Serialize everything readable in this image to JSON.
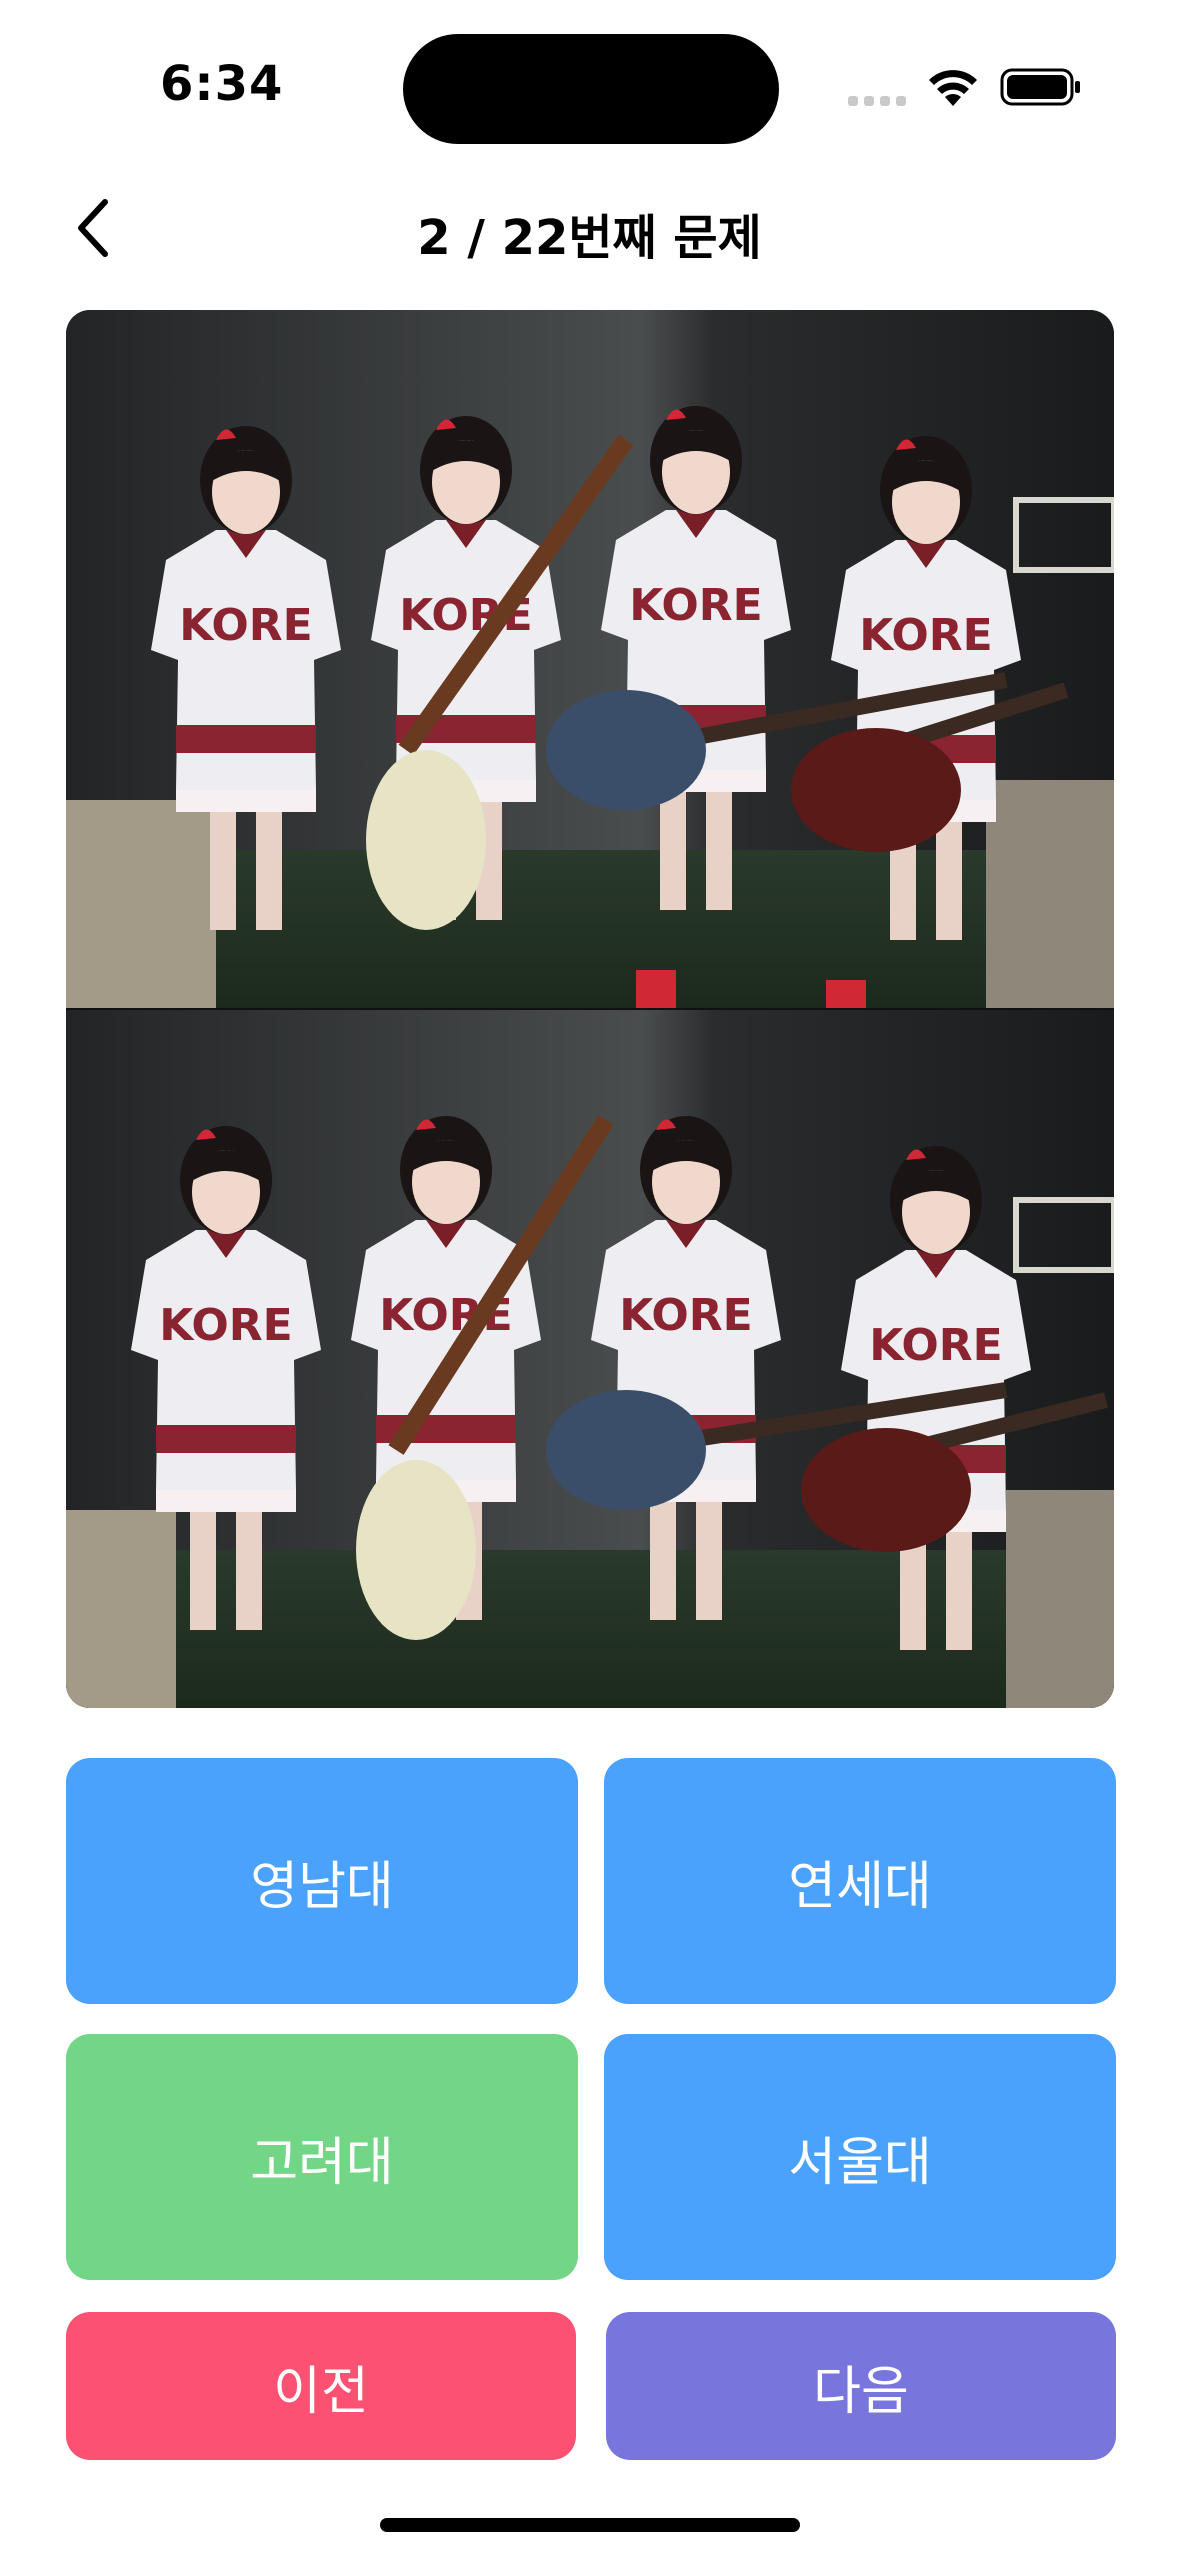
{
  "status_bar": {
    "time": "6:34",
    "icons": [
      "signal-icon",
      "wifi-icon",
      "battery-icon"
    ]
  },
  "header": {
    "title": "2 / 22번째 문제",
    "back_icon": "chevron-left-icon"
  },
  "photo": {
    "description_icon": "quiz-photo",
    "panels": 2
  },
  "answers": [
    {
      "label": "영남대",
      "color": "#4aa2fc"
    },
    {
      "label": "연세대",
      "color": "#4aa2fc"
    },
    {
      "label": "고려대",
      "color": "#72d686"
    },
    {
      "label": "서울대",
      "color": "#4aa2fc"
    }
  ],
  "navigation": {
    "prev_label": "이전",
    "prev_color": "#fc5172",
    "next_label": "다음",
    "next_color": "#7876dc"
  }
}
